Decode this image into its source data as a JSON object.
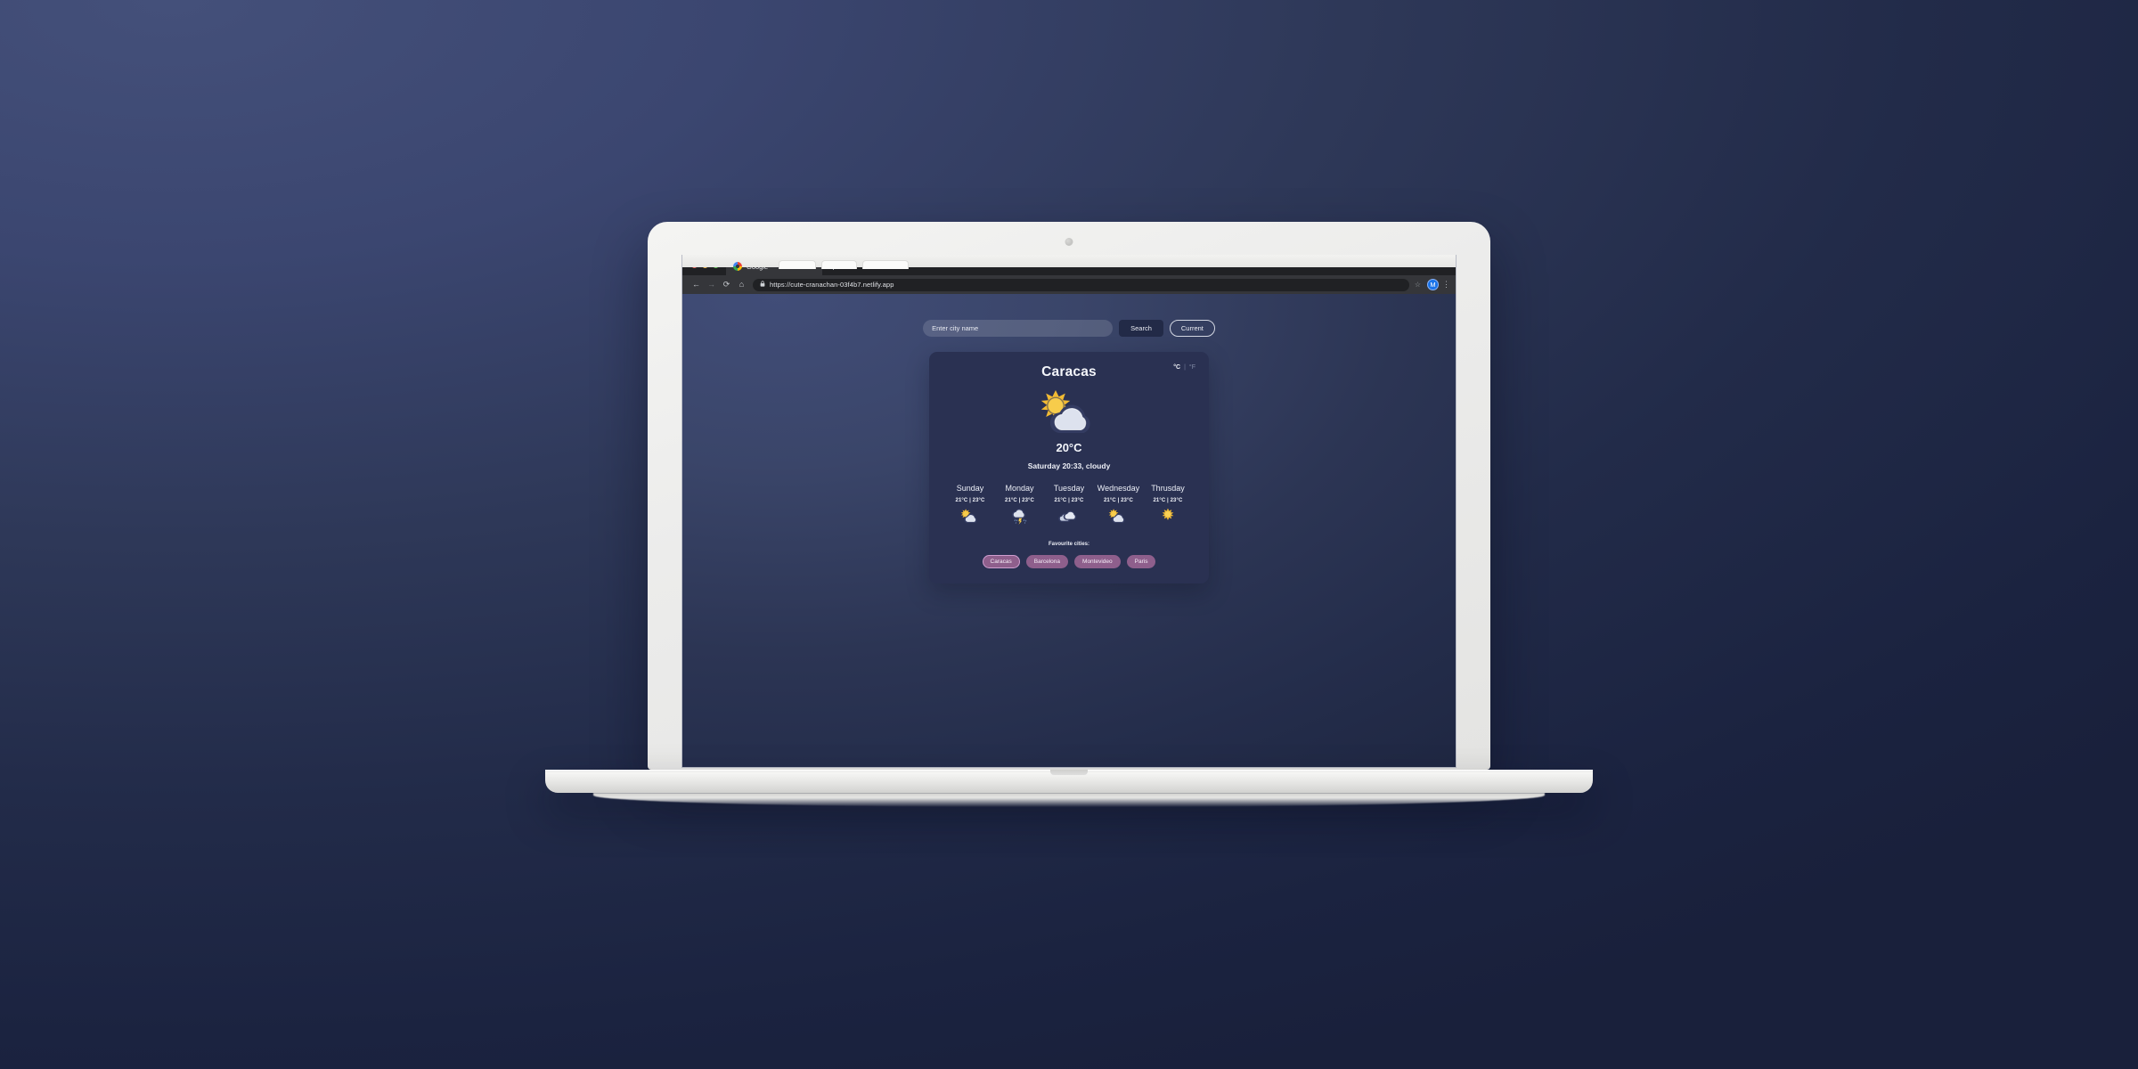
{
  "browser": {
    "tab": {
      "title": "Google",
      "favicon": "google-favicon",
      "close": "×"
    },
    "new_tab": "+",
    "nav": {
      "back": "←",
      "forward": "→",
      "reload": "⟳",
      "home": "⌂"
    },
    "omnibox": {
      "lock": "ὑ2",
      "url": "https://cute-cranachan-03f4b7.netlify.app"
    },
    "star": "☆",
    "avatar_initial": "M",
    "kebab": "⋮",
    "traffic_lights": [
      "close-red",
      "minimize-yellow",
      "maximize-green"
    ]
  },
  "search": {
    "placeholder": "Enter city name",
    "value": "",
    "search_label": "Search",
    "current_label": "Current"
  },
  "weather": {
    "city": "Caracas",
    "temperature": "20°C",
    "condition_line": "Saturday 20:33, cloudy",
    "icon": "partly-cloudy-icon",
    "units": {
      "celsius": "°C",
      "separator": "|",
      "fahrenheit": "°F",
      "active": "°C"
    }
  },
  "forecast": [
    {
      "day": "Sunday",
      "temps": "21°C | 23°C",
      "icon": "partly-cloudy-icon"
    },
    {
      "day": "Monday",
      "temps": "21°C | 23°C",
      "icon": "thunderstorm-rain-icon"
    },
    {
      "day": "Tuesday",
      "temps": "21°C | 23°C",
      "icon": "cloudy-icon"
    },
    {
      "day": "Wednesday",
      "temps": "21°C | 23°C",
      "icon": "partly-cloudy-icon"
    },
    {
      "day": "Thrusday",
      "temps": "21°C | 23°C",
      "icon": "sunny-icon"
    }
  ],
  "favourites": {
    "label": "Favourite cities:",
    "cities": [
      "Caracas",
      "Barcelona",
      "Montevideo",
      "Paris"
    ],
    "active": "Caracas"
  },
  "colors": {
    "desktop_light": "#44507a",
    "desktop_dark": "#1b2340",
    "page_bg": "#3a4569",
    "card_bg": "#2a3152",
    "chip_bg": "#8e5f8c",
    "chip_active_border": "#cf9ed0",
    "search_btn_bg": "#222a47",
    "chrome_bg": "#202124",
    "toolbar_bg": "#35363a",
    "avatar_blue": "#1a73e8",
    "sun_yellow": "#f5c33b",
    "cloud_light": "#dfe4ee"
  }
}
